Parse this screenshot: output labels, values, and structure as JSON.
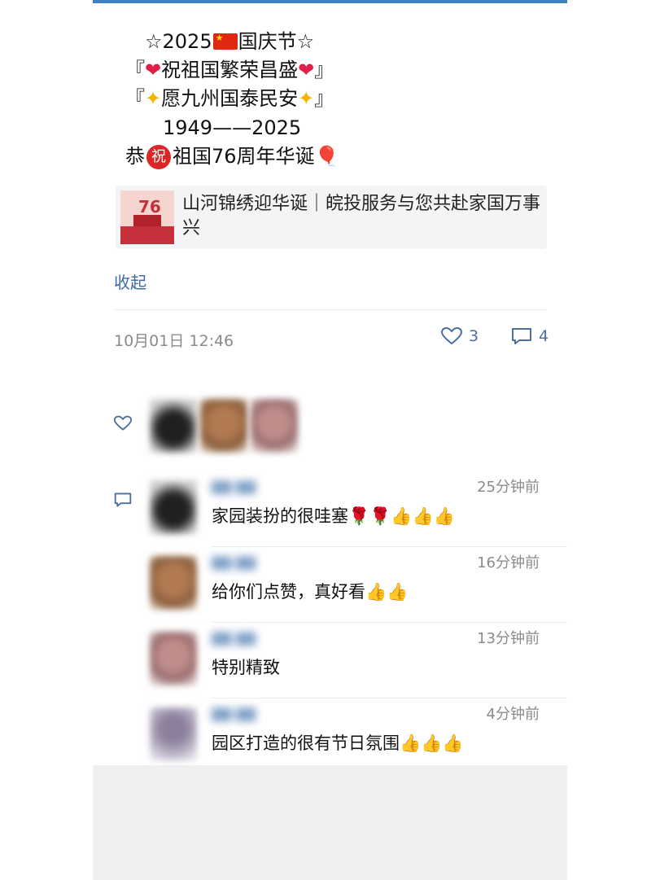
{
  "post": {
    "lines": [
      "☆2025🇨🇳国庆节☆",
      "『❤祝祖国繁荣昌盛❤』",
      "『🌟愿九州国泰民安🌟』",
      "1949——2025",
      "恭㊗祖国76周年华诞🎈"
    ],
    "line1_pre": "☆2025",
    "line1_post": "国庆节☆",
    "line2_open": "『",
    "line2_text": "祝祖国繁荣昌盛",
    "line2_close": "』",
    "line3_open": "『",
    "line3_text": "愿九州国泰民安",
    "line3_close": "』",
    "line4": "1949——2025",
    "line5_pre": "恭",
    "line5_circle": "祝",
    "line5_post": "祖国76周年华诞",
    "heart_glyph": "❤",
    "star_glyph": "✦",
    "balloon_glyph": "🎈"
  },
  "link_card": {
    "title": "山河锦绣迎华诞｜皖投服务与您共赴家国万事兴",
    "thumb_number": "76"
  },
  "collapse_label": "收起",
  "timestamp": "10月01日 12:46",
  "stats": {
    "likes": "3",
    "comments": "4",
    "like_icon": "heart-outline-icon",
    "comment_icon": "speech-bubble-icon"
  },
  "comments": [
    {
      "time": "25分钟前",
      "text": "家园装扮的很哇塞🌹🌹👍👍👍"
    },
    {
      "time": "16分钟前",
      "text": "给你们点赞，真好看👍👍"
    },
    {
      "time": "13分钟前",
      "text": "特别精致"
    },
    {
      "time": "4分钟前",
      "text": "园区打造的很有节日氛围👍👍👍"
    }
  ],
  "colors": {
    "accent": "#3b82c4",
    "link_blue": "#3b6ba5",
    "stat_blue": "#4a6fa0",
    "muted": "#8b8b8b",
    "bottom_bg": "#eeeff1"
  }
}
